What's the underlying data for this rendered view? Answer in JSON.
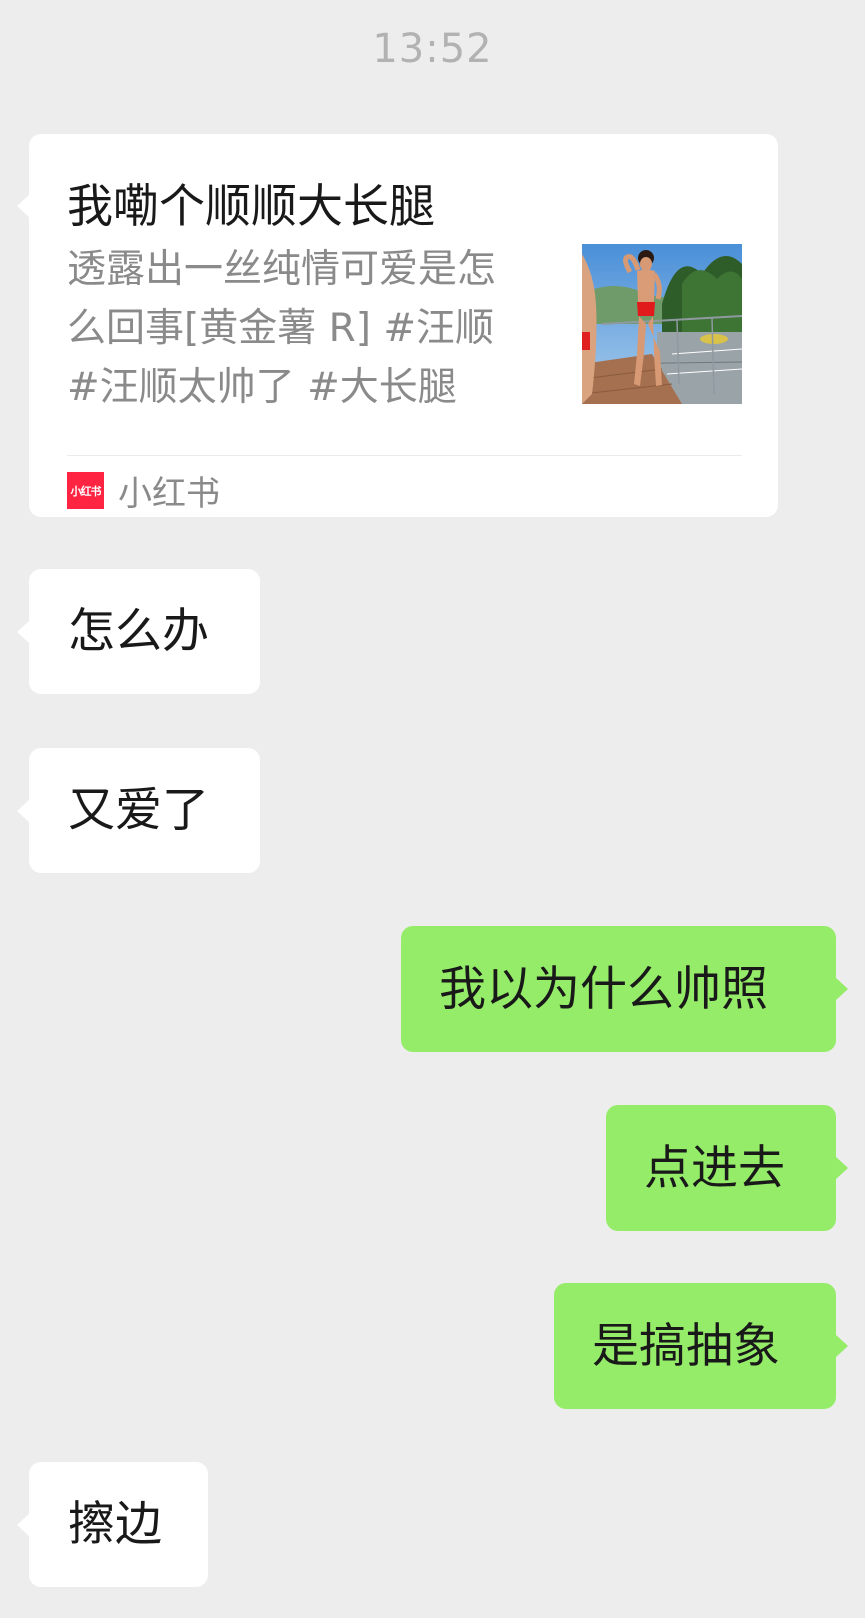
{
  "timestamp": "13:52",
  "link_card": {
    "title": "我嘞个顺顺大长腿",
    "description_lines": [
      "透露出一丝纯情可爱是怎",
      "么回事[黄金薯 R] #汪顺",
      "#汪顺太帅了  #大长腿"
    ],
    "source_logo_text": "小红书",
    "source_name": "小红书",
    "source_color": "#ff2442"
  },
  "messages": [
    {
      "side": "left",
      "text": "怎么办"
    },
    {
      "side": "left",
      "text": "又爱了"
    },
    {
      "side": "right",
      "text": "我以为什么帅照"
    },
    {
      "side": "right",
      "text": "点进去"
    },
    {
      "side": "right",
      "text": "是搞抽象"
    },
    {
      "side": "left",
      "text": "擦边"
    }
  ],
  "colors": {
    "background": "#ededed",
    "received_bubble": "#ffffff",
    "sent_bubble": "#95ec69"
  }
}
